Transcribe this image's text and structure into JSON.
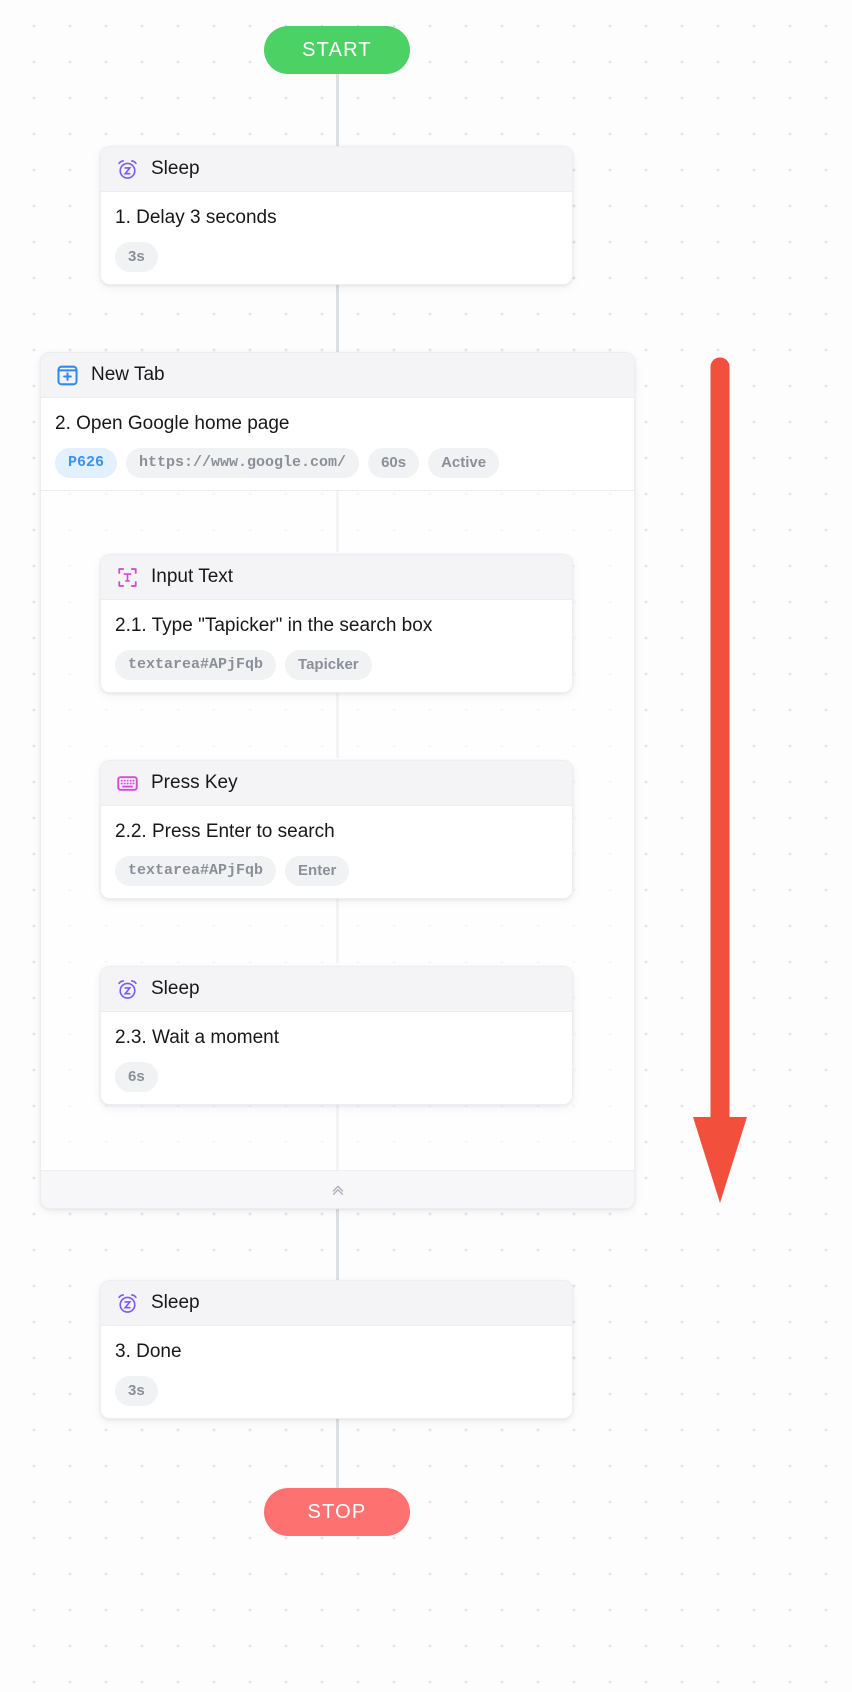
{
  "flow": {
    "start_label": "START",
    "stop_label": "STOP",
    "start_color": "#4cd164",
    "stop_color": "#fd7171",
    "collapse_icon": "chevron-double-up-icon"
  },
  "nodes": [
    {
      "id": "sleep-1",
      "icon": "alarm-clock-sleep-icon",
      "icon_color": "#7b5cf0",
      "type_label": "Sleep",
      "description": "1. Delay 3 seconds",
      "tags": [
        {
          "text": "3s",
          "style": "default",
          "mono": false
        }
      ]
    },
    {
      "id": "new-tab-2",
      "icon": "new-tab-plus-icon",
      "icon_color": "#2b8bf2",
      "type_label": "New Tab",
      "description": "2. Open Google home page",
      "tags": [
        {
          "text": "P626",
          "style": "blue",
          "mono": true
        },
        {
          "text": "https://www.google.com/",
          "style": "default",
          "mono": true
        },
        {
          "text": "60s",
          "style": "default",
          "mono": false
        },
        {
          "text": "Active",
          "style": "default",
          "mono": false
        }
      ],
      "children": [
        {
          "id": "input-text-2-1",
          "icon": "input-text-bracket-icon",
          "icon_color": "#d44ad4",
          "type_label": "Input Text",
          "description": "2.1. Type \"Tapicker\" in the search box",
          "tags": [
            {
              "text": "textarea#APjFqb",
              "style": "default",
              "mono": true
            },
            {
              "text": "Tapicker",
              "style": "default",
              "mono": false
            }
          ]
        },
        {
          "id": "press-key-2-2",
          "icon": "keyboard-icon",
          "icon_color": "#d44ad4",
          "type_label": "Press Key",
          "description": "2.2. Press Enter to search",
          "tags": [
            {
              "text": "textarea#APjFqb",
              "style": "default",
              "mono": true
            },
            {
              "text": "Enter",
              "style": "default",
              "mono": false
            }
          ]
        },
        {
          "id": "sleep-2-3",
          "icon": "alarm-clock-sleep-icon",
          "icon_color": "#7b5cf0",
          "type_label": "Sleep",
          "description": "2.3. Wait a moment",
          "tags": [
            {
              "text": "6s",
              "style": "default",
              "mono": false
            }
          ]
        }
      ]
    },
    {
      "id": "sleep-3",
      "icon": "alarm-clock-sleep-icon",
      "icon_color": "#7b5cf0",
      "type_label": "Sleep",
      "description": "3. Done",
      "tags": [
        {
          "text": "3s",
          "style": "default",
          "mono": false
        }
      ]
    }
  ],
  "annotation": {
    "name": "scroll-down-arrow",
    "color": "#f2503c",
    "direction": "down"
  }
}
